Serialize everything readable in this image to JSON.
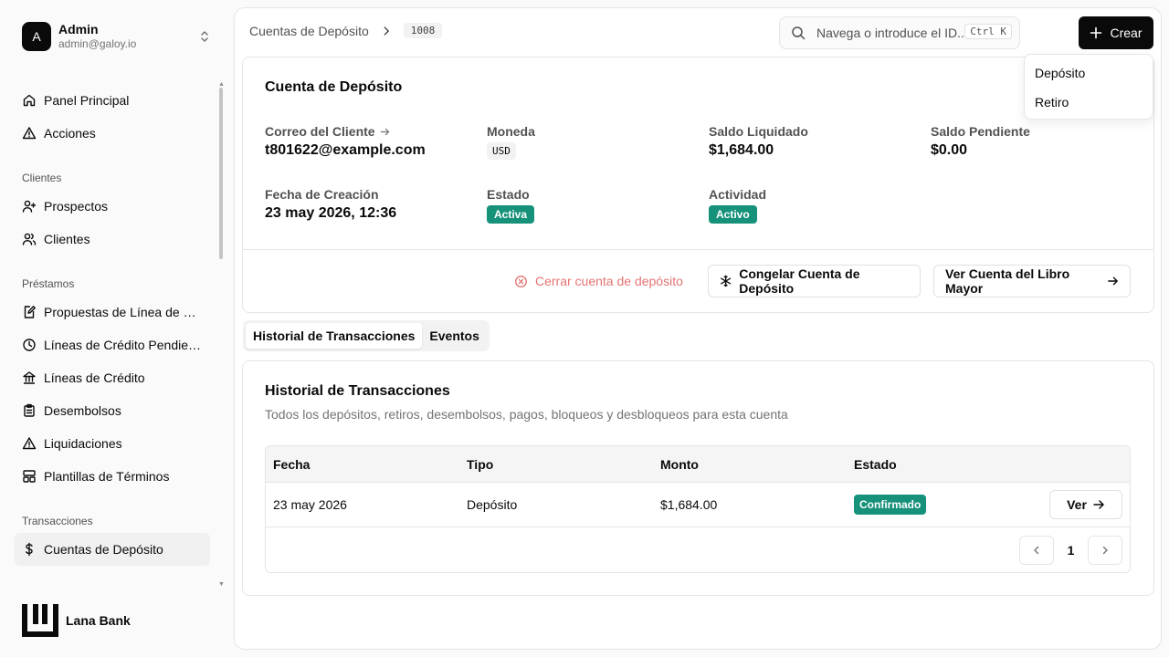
{
  "user": {
    "initial": "A",
    "name": "Admin",
    "email": "admin@galoy.io"
  },
  "nav": {
    "top": [
      {
        "label": "Panel Principal",
        "icon": "home-icon"
      },
      {
        "label": "Acciones",
        "icon": "alert-triangle-icon"
      }
    ],
    "groups": [
      {
        "title": "Clientes",
        "items": [
          "Prospectos",
          "Clientes"
        ]
      },
      {
        "title": "Préstamos",
        "items": [
          "Propuestas de Línea de Cr...",
          "Líneas de Crédito Pendient...",
          "Líneas de Crédito",
          "Desembolsos",
          "Liquidaciones",
          "Plantillas de Términos"
        ]
      },
      {
        "title": "Transacciones",
        "items": [
          "Cuentas de Depósito"
        ]
      }
    ]
  },
  "brand": {
    "name": "Lana Bank"
  },
  "breadcrumb": {
    "section": "Cuentas de Depósito",
    "id": "1008"
  },
  "search": {
    "placeholder": "Navega o introduce el ID...",
    "shortcut": "Ctrl K"
  },
  "create": {
    "label": "Crear",
    "menu": [
      "Depósito",
      "Retiro"
    ]
  },
  "account": {
    "title": "Cuenta de Depósito",
    "email_label": "Correo del Cliente",
    "email": "t801622@example.com",
    "currency_label": "Moneda",
    "currency": "USD",
    "settled_label": "Saldo Liquidado",
    "settled": "$1,684.00",
    "pending_label": "Saldo Pendiente",
    "pending": "$0.00",
    "created_label": "Fecha de Creación",
    "created": "23 may 2026, 12:36",
    "status_label": "Estado",
    "status": "Activa",
    "activity_label": "Actividad",
    "activity": "Activo",
    "close_label": "Cerrar cuenta de depósito",
    "freeze_label": "Congelar Cuenta de Depósito",
    "ledger_label": "Ver Cuenta del Libro Mayor"
  },
  "tabs": [
    "Historial de Transacciones",
    "Eventos"
  ],
  "history": {
    "title": "Historial de Transacciones",
    "description": "Todos los depósitos, retiros, desembolsos, pagos, bloqueos y desbloqueos para esta cuenta",
    "columns": [
      "Fecha",
      "Tipo",
      "Monto",
      "Estado"
    ],
    "rows": [
      {
        "date": "23 may 2026",
        "type": "Depósito",
        "amount": "$1,684.00",
        "status": "Confirmado",
        "action": "Ver"
      }
    ],
    "page": "1"
  },
  "colors": {
    "accent_green": "#16917a",
    "danger": "#e57373",
    "primary": "#0a0a0a"
  }
}
